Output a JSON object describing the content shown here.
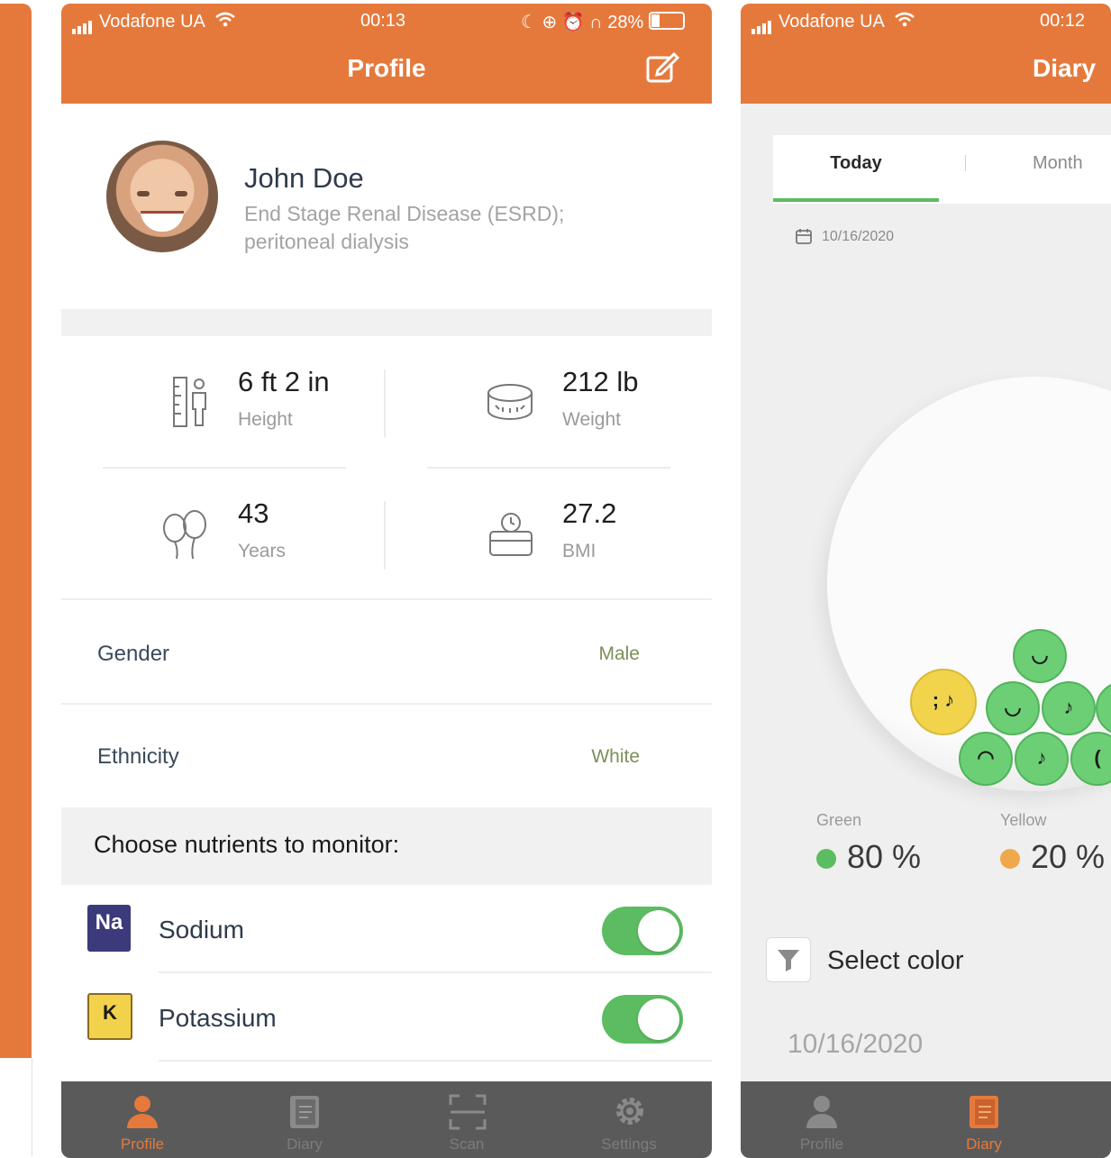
{
  "profile_screen": {
    "status": {
      "carrier": "Vodafone UA",
      "time": "00:13",
      "battery": "28%"
    },
    "title": "Profile",
    "user": {
      "name": "John Doe",
      "condition": "End Stage Renal Disease (ESRD); peritoneal dialysis"
    },
    "stats": [
      {
        "value": "6 ft 2 in",
        "label": "Height",
        "icon": "ruler-person-icon"
      },
      {
        "value": "212 lb",
        "label": "Weight",
        "icon": "tape-measure-icon"
      },
      {
        "value": "43",
        "label": "Years",
        "icon": "balloons-icon"
      },
      {
        "value": "27.2",
        "label": "BMI",
        "icon": "scale-icon"
      }
    ],
    "rows": [
      {
        "label": "Gender",
        "value": "Male"
      },
      {
        "label": "Ethnicity",
        "value": "White"
      }
    ],
    "nutrients_header": "Choose nutrients to monitor:",
    "nutrients": [
      {
        "symbol": "Na",
        "name": "Sodium",
        "enabled": true,
        "color": "#3b3a7a"
      },
      {
        "symbol": "K",
        "name": "Potassium",
        "enabled": true,
        "color": "#f2d24a"
      }
    ],
    "tabs": [
      {
        "label": "Profile",
        "active": true
      },
      {
        "label": "Diary",
        "active": false
      },
      {
        "label": "Scan",
        "active": false
      },
      {
        "label": "Settings",
        "active": false
      }
    ]
  },
  "diary_screen": {
    "status": {
      "carrier": "Vodafone UA",
      "time": "00:12"
    },
    "title": "Diary",
    "segments": [
      "Today",
      "Month"
    ],
    "date_small": "10/16/2020",
    "legend": [
      {
        "label": "Green",
        "value": "80 %",
        "color": "#5cbc61"
      },
      {
        "label": "Yellow",
        "value": "20 %",
        "color": "#f0a84c"
      }
    ],
    "filter_label": "Select color",
    "date_large": "10/16/2020",
    "tabs": [
      {
        "label": "Profile",
        "active": false
      },
      {
        "label": "Diary",
        "active": true
      }
    ]
  },
  "colors": {
    "accent": "#e5793c",
    "toggle_on": "#5cbc61",
    "tabbar": "#5a5a5a"
  }
}
